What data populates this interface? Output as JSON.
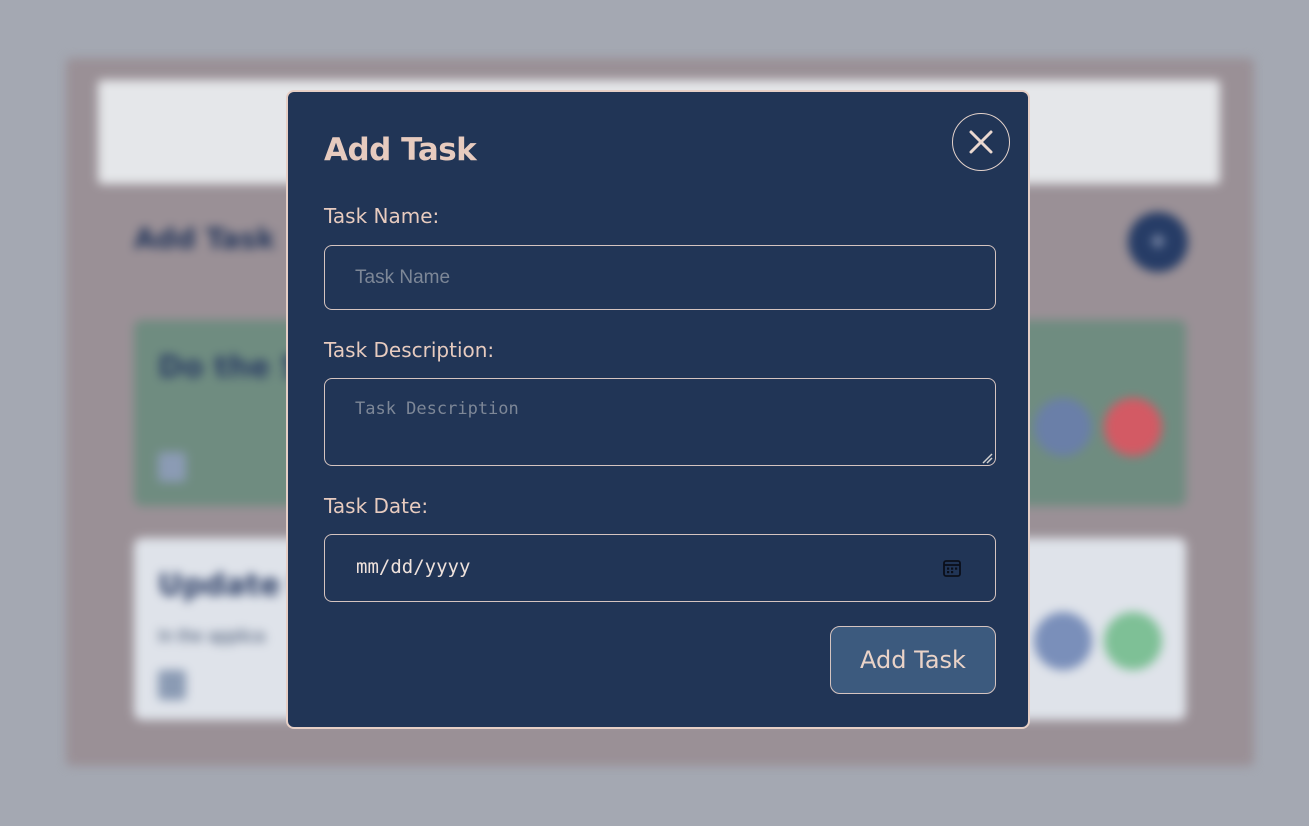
{
  "background": {
    "section_title": "Add Task",
    "add_button_glyph": "+",
    "cards": [
      {
        "title": "Do the S",
        "desc": "",
        "date": "",
        "status": "done"
      },
      {
        "title": "Update t",
        "desc": "In the applica",
        "date": "",
        "status": "todo"
      }
    ]
  },
  "modal": {
    "title": "Add Task",
    "close_icon": "close-icon",
    "fields": {
      "name_label": "Task Name:",
      "name_placeholder": "Task Name",
      "name_value": "",
      "description_label": "Task Description:",
      "description_placeholder": "Task Description",
      "description_value": "",
      "date_label": "Task Date:",
      "date_placeholder": "mm/dd/yyyy",
      "date_icon": "calendar-icon"
    },
    "submit_label": "Add Task"
  },
  "colors": {
    "overlay": "#a4a8b2",
    "modal_bg": "#213556",
    "modal_border": "#e6cfc6",
    "text_accent": "#e7cbbf",
    "button_bg": "#3c5a7e"
  }
}
